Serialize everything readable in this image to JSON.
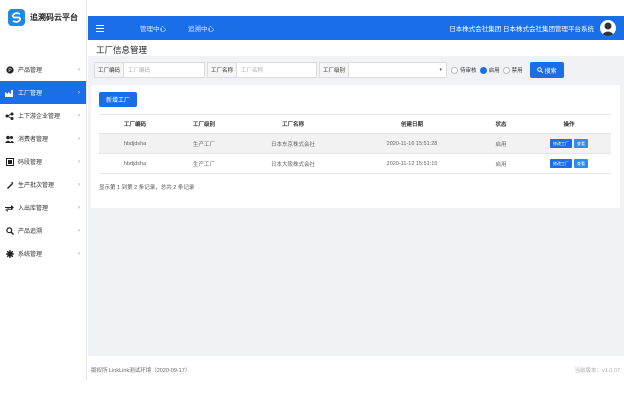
{
  "brand": {
    "name": "追溯码云平台"
  },
  "sidebar": {
    "items": [
      {
        "label": "产品管理",
        "icon": "product-icon"
      },
      {
        "label": "工厂管理",
        "icon": "factory-icon",
        "active": true
      },
      {
        "label": "上下游企业管理",
        "icon": "partner-icon"
      },
      {
        "label": "消费者管理",
        "icon": "users-icon"
      },
      {
        "label": "码段管理",
        "icon": "barcode-icon"
      },
      {
        "label": "生产批次管理",
        "icon": "batch-icon"
      },
      {
        "label": "入出库管理",
        "icon": "transfer-icon"
      },
      {
        "label": "产品追溯",
        "icon": "search-icon"
      },
      {
        "label": "系统管理",
        "icon": "gear-icon"
      }
    ]
  },
  "header": {
    "tabs": [
      "管理中心",
      "追溯中心"
    ],
    "company": "日本株式会社集团 日本株式会社集团管理平台系统",
    "colors": {
      "primary": "#1a6fe8"
    }
  },
  "page": {
    "title": "工厂信息管理"
  },
  "filter": {
    "code_label": "工厂编码",
    "code_placeholder": "工厂编码",
    "name_label": "工厂名称",
    "name_placeholder": "工厂名称",
    "level_label": "工厂级别",
    "level_value": "",
    "radios": [
      {
        "label": "待审核",
        "checked": false
      },
      {
        "label": "启用",
        "checked": true
      },
      {
        "label": "禁用",
        "checked": false
      }
    ],
    "search_label": "搜索"
  },
  "table": {
    "add_label": "新增工厂",
    "columns": [
      "工厂编码",
      "工厂级别",
      "工厂名称",
      "创建日期",
      "状态",
      "操作"
    ],
    "rows": [
      {
        "code": "hbdjdsha",
        "level": "生产工厂",
        "name": "日本东京株式会社",
        "date": "2020-11-16 15:51:28",
        "status": "启用",
        "actions": [
          "修改工厂",
          "查看"
        ]
      },
      {
        "code": "hbdjdsha",
        "level": "生产工厂",
        "name": "日本大阪株式会社",
        "date": "2020-11-12 15:51:15",
        "status": "启用",
        "actions": [
          "修改工厂",
          "查看"
        ]
      }
    ],
    "summary": "显示第 1 到第 2 条记录，总共 2 条记录"
  },
  "footer": {
    "left": "版权所 LinkLink测试环境（2020-09-17）",
    "right": "当前版本：v1.0.07"
  }
}
